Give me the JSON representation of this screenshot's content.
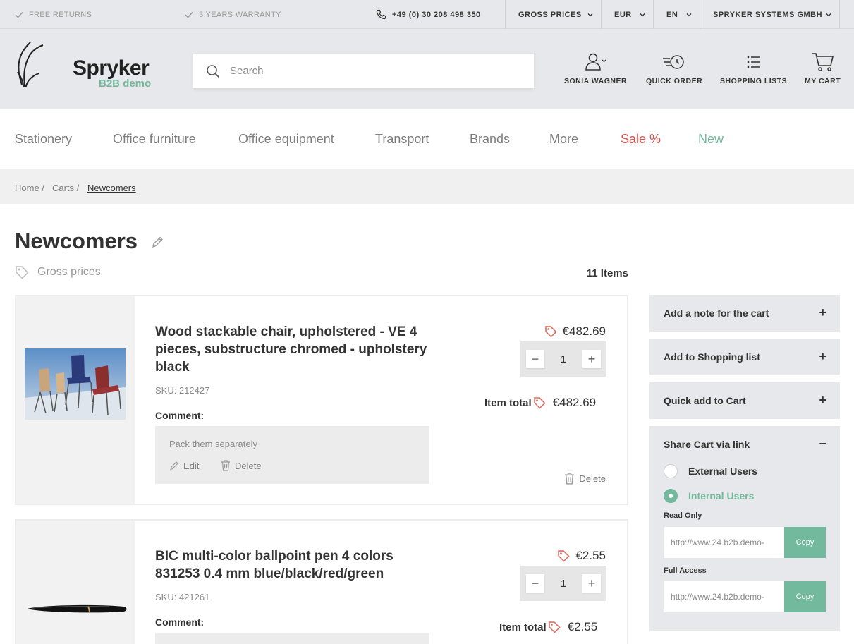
{
  "topbar": {
    "free_returns": "FREE RETURNS",
    "warranty": "3 YEARS WARRANTY",
    "phone": "+49 (0) 30 208 498 350",
    "price_mode": "GROSS PRICES",
    "currency": "EUR",
    "language": "EN",
    "company": "SPRYKER SYSTEMS GMBH"
  },
  "header": {
    "logo_name": "Spryker",
    "logo_sub": "B2B demo",
    "search_placeholder": "Search",
    "user": "SONIA WAGNER",
    "quick_order": "QUICK ORDER",
    "shopping_lists": "SHOPPING LISTS",
    "my_cart": "MY CART"
  },
  "nav": [
    "Stationery",
    "Office furniture",
    "Office equipment",
    "Transport",
    "Brands",
    "More",
    "Sale %",
    "New"
  ],
  "breadcrumb": [
    "Home",
    "Carts",
    "Newcomers"
  ],
  "page": {
    "title": "Newcomers",
    "price_mode": "Gross prices",
    "item_count": "11 Items"
  },
  "items": [
    {
      "name": "Wood stackable chair, upholstered - VE 4 pieces, substructure chromed - upholstery black",
      "sku": "SKU: 212427",
      "comment_label": "Comment:",
      "comment": "Pack them separately",
      "edit_label": "Edit",
      "delete_comment_label": "Delete",
      "price": "€482.69",
      "quantity": "1",
      "total_label": "Item total",
      "total": "€482.69",
      "delete_label": "Delete"
    },
    {
      "name": "BIC multi-color ballpoint pen 4 colors 831253 0.4 mm blue/black/red/green",
      "sku": "SKU: 421261",
      "comment_label": "Comment:",
      "price": "€2.55",
      "quantity": "1",
      "total_label": "Item total",
      "total": "€2.55"
    }
  ],
  "sidebar": {
    "note": "Add a note for the cart",
    "shopping_list": "Add to Shopping list",
    "quick_add": "Quick add to Cart",
    "share": "Share Cart via link",
    "external": "External Users",
    "internal": "Internal Users",
    "read_only_label": "Read Only",
    "read_only_url": "http://www.24.b2b.demo-",
    "full_access_label": "Full Access",
    "full_access_url": "http://www.24.b2b.demo-",
    "copy_label": "Copy"
  },
  "colors": {
    "accent": "#73b99d",
    "sale": "#d9534f",
    "header_bg": "#e7e8eb"
  }
}
